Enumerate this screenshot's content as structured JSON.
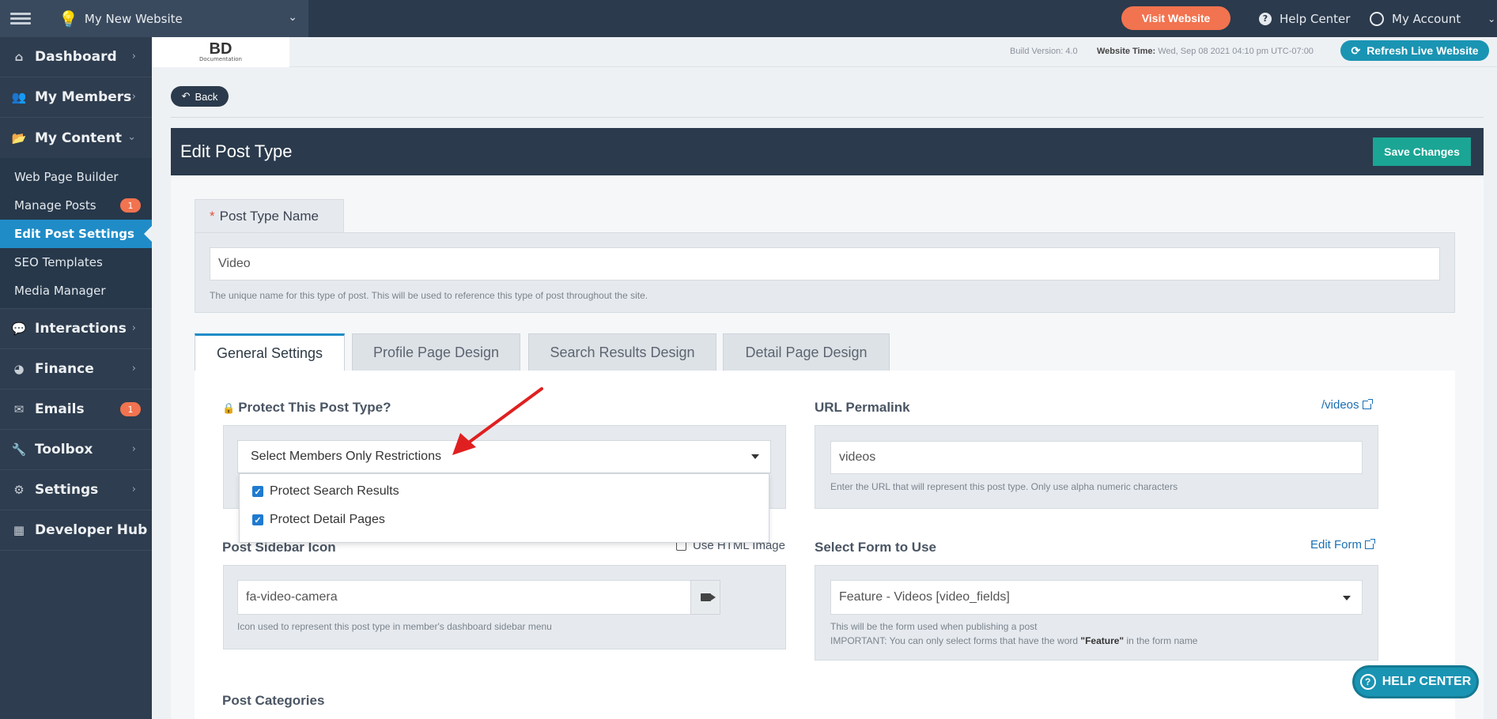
{
  "topbar": {
    "site_name": "My New Website",
    "visit_website": "Visit Website",
    "help_center": "Help Center",
    "my_account": "My Account"
  },
  "sidebar": {
    "items": [
      {
        "label": "Dashboard",
        "icon": "home-icon"
      },
      {
        "label": "My Members",
        "icon": "users-icon"
      },
      {
        "label": "My Content",
        "icon": "folder-open-icon"
      },
      {
        "label": "Interactions",
        "icon": "comments-icon"
      },
      {
        "label": "Finance",
        "icon": "pie-chart-icon"
      },
      {
        "label": "Emails",
        "icon": "inbox-icon",
        "badge": "1"
      },
      {
        "label": "Toolbox",
        "icon": "wrench-icon"
      },
      {
        "label": "Settings",
        "icon": "gear-icon"
      },
      {
        "label": "Developer Hub",
        "icon": "grid-icon"
      }
    ],
    "submenu": [
      {
        "label": "Web Page Builder"
      },
      {
        "label": "Manage Posts",
        "badge": "1"
      },
      {
        "label": "Edit Post Settings"
      },
      {
        "label": "SEO Templates"
      },
      {
        "label": "Media Manager"
      }
    ]
  },
  "subheader": {
    "logo_main": "BD",
    "logo_sub": "Documentation",
    "build_version": "Build Version: 4.0",
    "website_time_label": "Website Time:",
    "website_time_value": "Wed, Sep 08 2021 04:10 pm UTC-07:00",
    "refresh_live": "Refresh Live Website"
  },
  "back_label": "Back",
  "panel": {
    "title": "Edit Post Type",
    "save_label": "Save Changes",
    "post_type_name": {
      "label": "Post Type Name",
      "required_mark": "*",
      "value": "Video",
      "help": "The unique name for this type of post. This will be used to reference this type of post throughout the site."
    },
    "tabs": [
      {
        "label": "General Settings",
        "active": true
      },
      {
        "label": "Profile Page Design"
      },
      {
        "label": "Search Results Design"
      },
      {
        "label": "Detail Page Design"
      }
    ],
    "protect": {
      "label": "Protect This Post Type?",
      "select_value": "Select Members Only Restrictions",
      "options": [
        {
          "label": "Protect Search Results",
          "checked": true
        },
        {
          "label": "Protect Detail Pages",
          "checked": true
        }
      ]
    },
    "url_permalink": {
      "label": "URL Permalink",
      "link": "/videos",
      "value": "videos",
      "help": "Enter the URL that will represent this post type. Only use alpha numeric characters"
    },
    "sidebar_icon": {
      "label": "Post Sidebar Icon",
      "use_html_image": "Use HTML Image",
      "value": "fa-video-camera",
      "help": "Icon used to represent this post type in member's dashboard sidebar menu"
    },
    "form": {
      "label": "Select Form to Use",
      "link": "Edit Form",
      "value": "Feature - Videos [video_fields]",
      "help1": "This will be the form used when publishing a post",
      "help2_pre": "IMPORTANT: You can only select forms that have the word ",
      "help2_bold": "\"Feature\"",
      "help2_post": " in the form name"
    },
    "categories_label": "Post Categories"
  },
  "help_float": "HELP CENTER",
  "colors": {
    "topbar": "#2b3a4c",
    "accent_orange": "#f2734f",
    "accent_blue": "#1f8cc7",
    "accent_teal": "#1aa594",
    "annotation_red": "#e02020"
  }
}
